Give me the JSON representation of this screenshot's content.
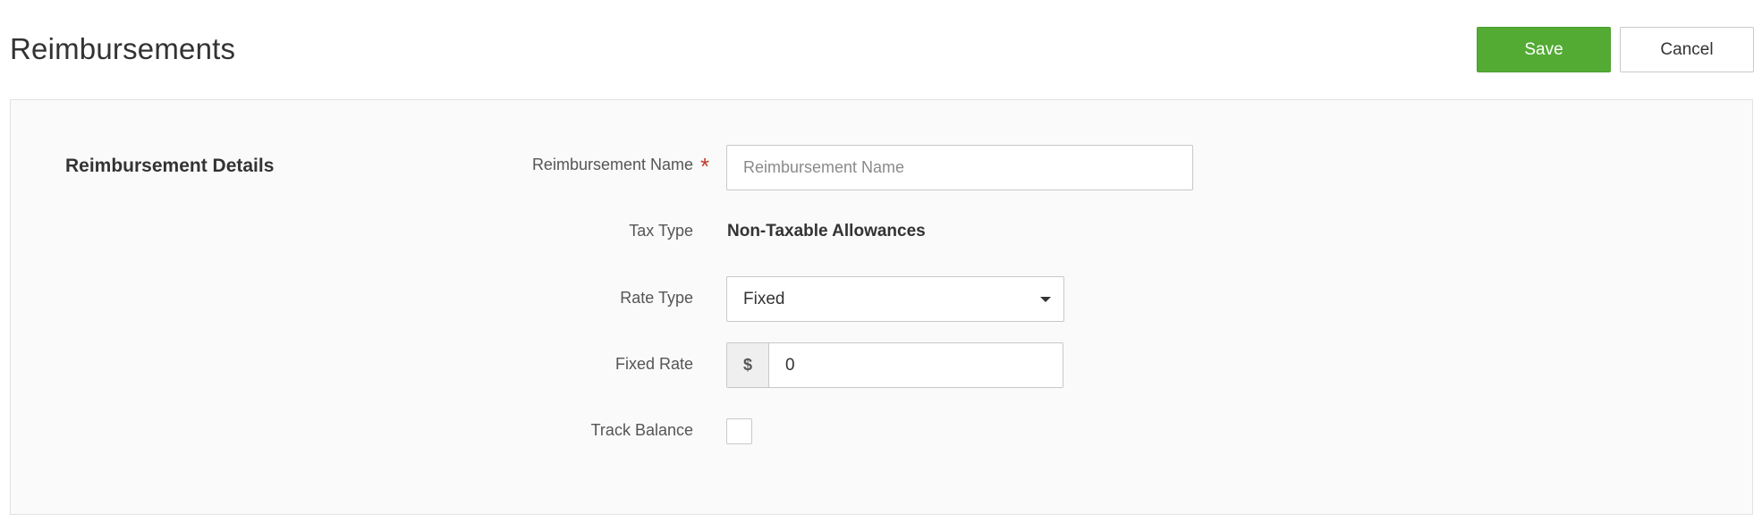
{
  "header": {
    "title": "Reimbursements",
    "save_label": "Save",
    "cancel_label": "Cancel"
  },
  "colors": {
    "save_button": "#53ab34",
    "required_star": "#c0392b"
  },
  "details": {
    "section_title": "Reimbursement Details",
    "name": {
      "label": "Reimbursement Name",
      "required_mark": "*",
      "value": "",
      "placeholder": "Reimbursement Name"
    },
    "tax_type": {
      "label": "Tax Type",
      "value": "Non-Taxable Allowances"
    },
    "rate_type": {
      "label": "Rate Type",
      "selected": "Fixed",
      "caret_icon": "caret-down-icon"
    },
    "fixed_rate": {
      "label": "Fixed Rate",
      "prefix": "$",
      "value": "0"
    },
    "track_balance": {
      "label": "Track Balance",
      "checked": false
    }
  }
}
